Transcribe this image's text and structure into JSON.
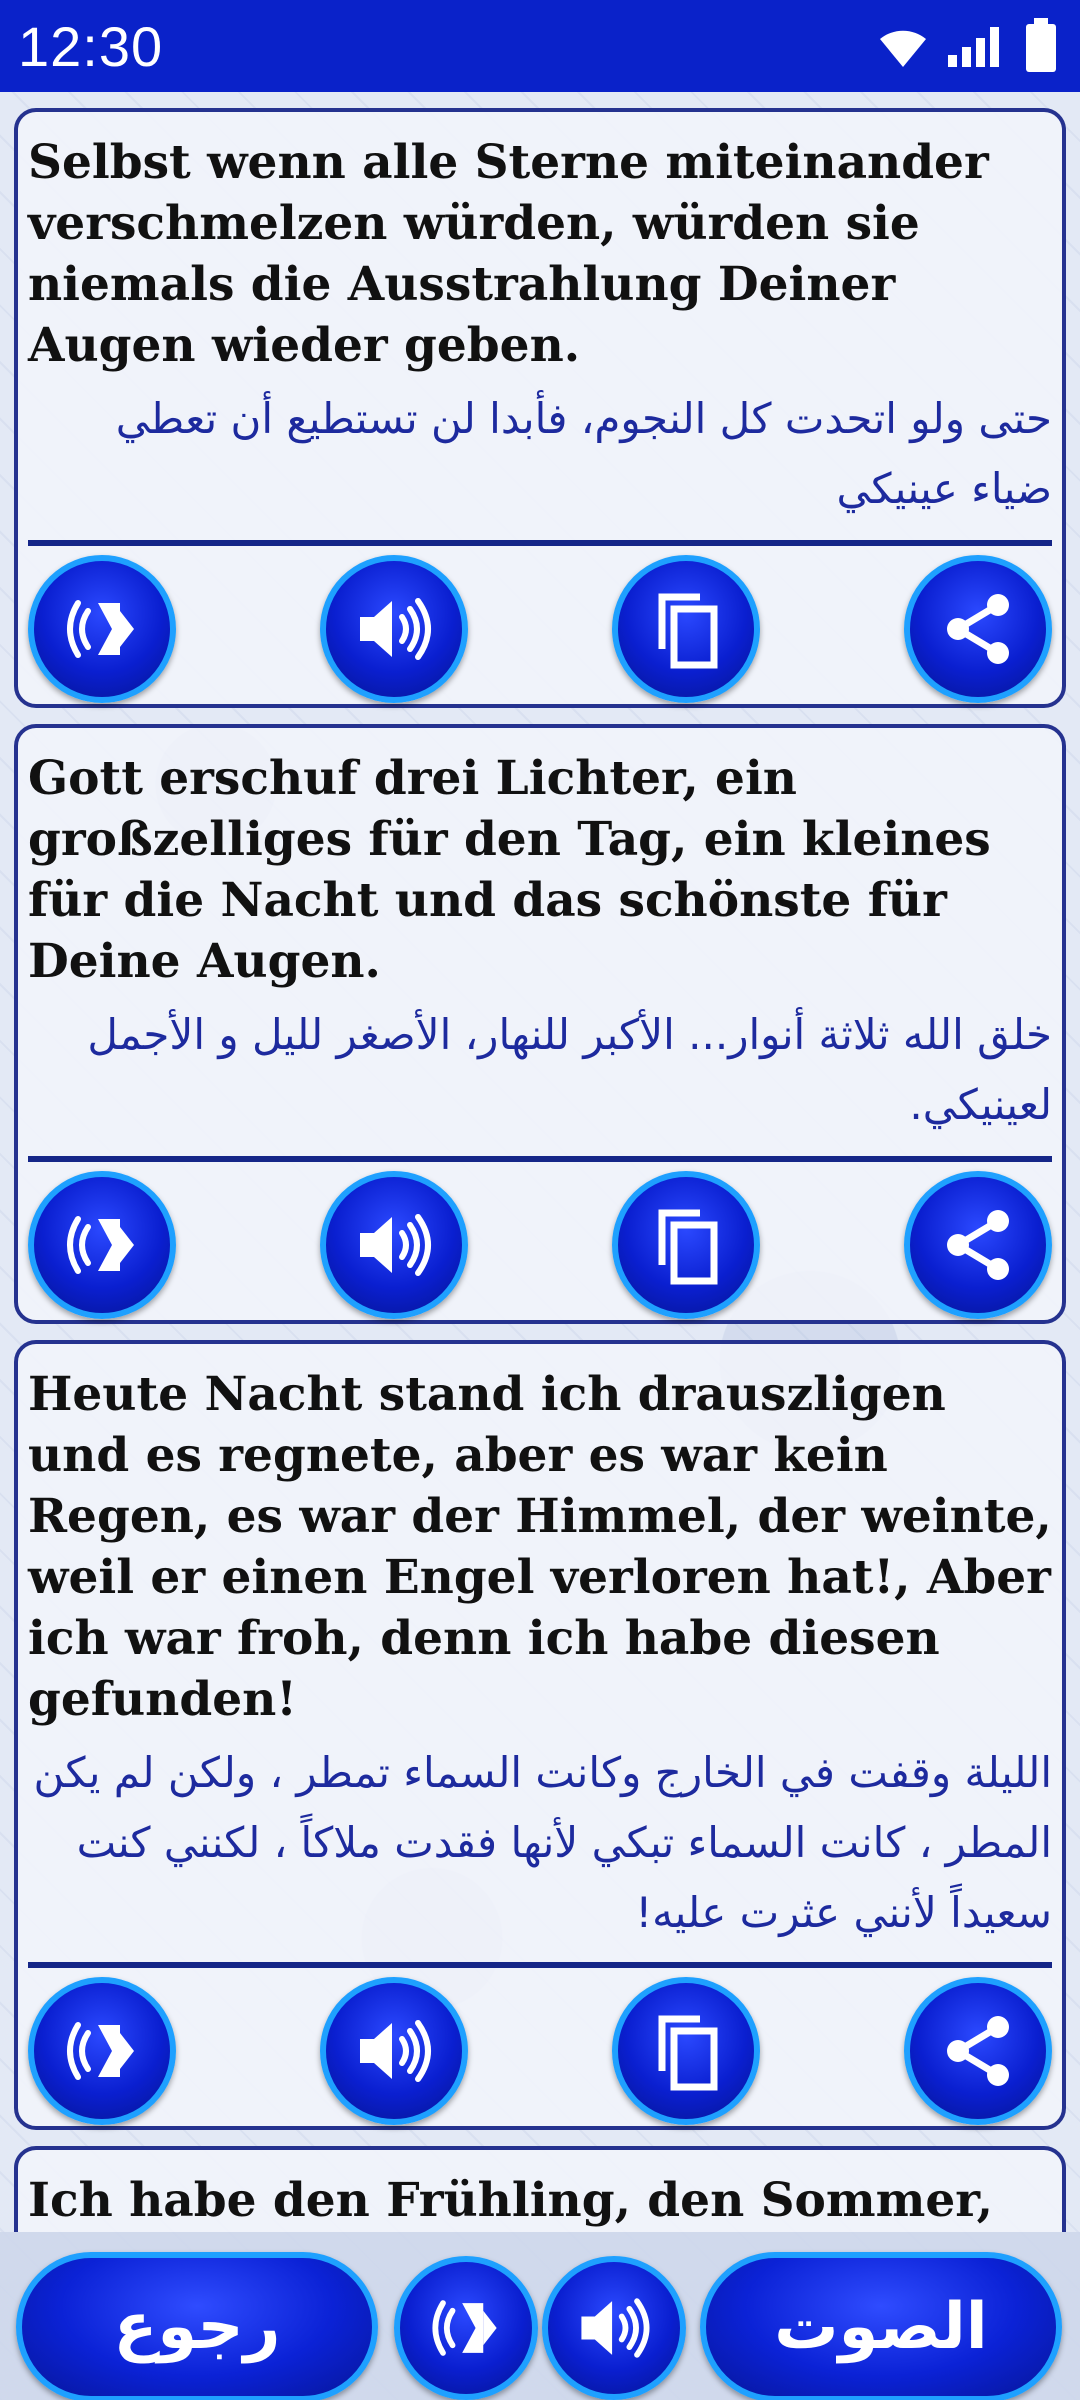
{
  "status_bar": {
    "time": "12:30",
    "icons": [
      "wifi-icon",
      "signal-icon",
      "battery-icon"
    ]
  },
  "phrases": [
    {
      "german": "Selbst wenn alle Sterne miteinander verschmelzen würden, würden sie niemals die Ausstrahlung Deiner Augen wieder geben.",
      "arabic": "حتى ولو اتحدت كل النجوم، فأبدا لن تستطيع أن تعطي ضياء عينيكي"
    },
    {
      "german": "Gott erschuf drei Lichter, ein großzelliges für den Tag, ein kleines für die Nacht und das schönste für Deine Augen.",
      "arabic": "خلق الله ثلاثة أنوار... الأكبر للنهار، الأصغر لليل و الأجمل لعينيكي."
    },
    {
      "german": "Heute Nacht stand ich drauszligen und es regnete, aber es war kein Regen, es war der Himmel, der weinte, weil er einen Engel verloren hat!, Aber ich war froh, denn ich habe diesen gefunden!",
      "arabic": "الليلة وقفت في الخارج وكانت السماء تمطر ، ولكن لم يكن المطر ، كانت السماء تبكي لأنها فقدت ملاكاً ، لكنني كنت سعيداً لأنني عثرت عليه!"
    },
    {
      "german": "Ich habe den Frühling, den Sommer,",
      "arabic": ""
    }
  ],
  "card_actions": [
    "slow-speaker-icon",
    "speaker-icon",
    "copy-icon",
    "share-icon"
  ],
  "bottom_bar": {
    "back_label": "رجوع",
    "sound_label": "الصوت"
  },
  "colors": {
    "status_bar": "#0a22c9",
    "card_border": "#25328f",
    "arabic_text": "#1d2a9e",
    "button_fill": "#0a1fd0",
    "button_ring": "#1ea0ff"
  }
}
